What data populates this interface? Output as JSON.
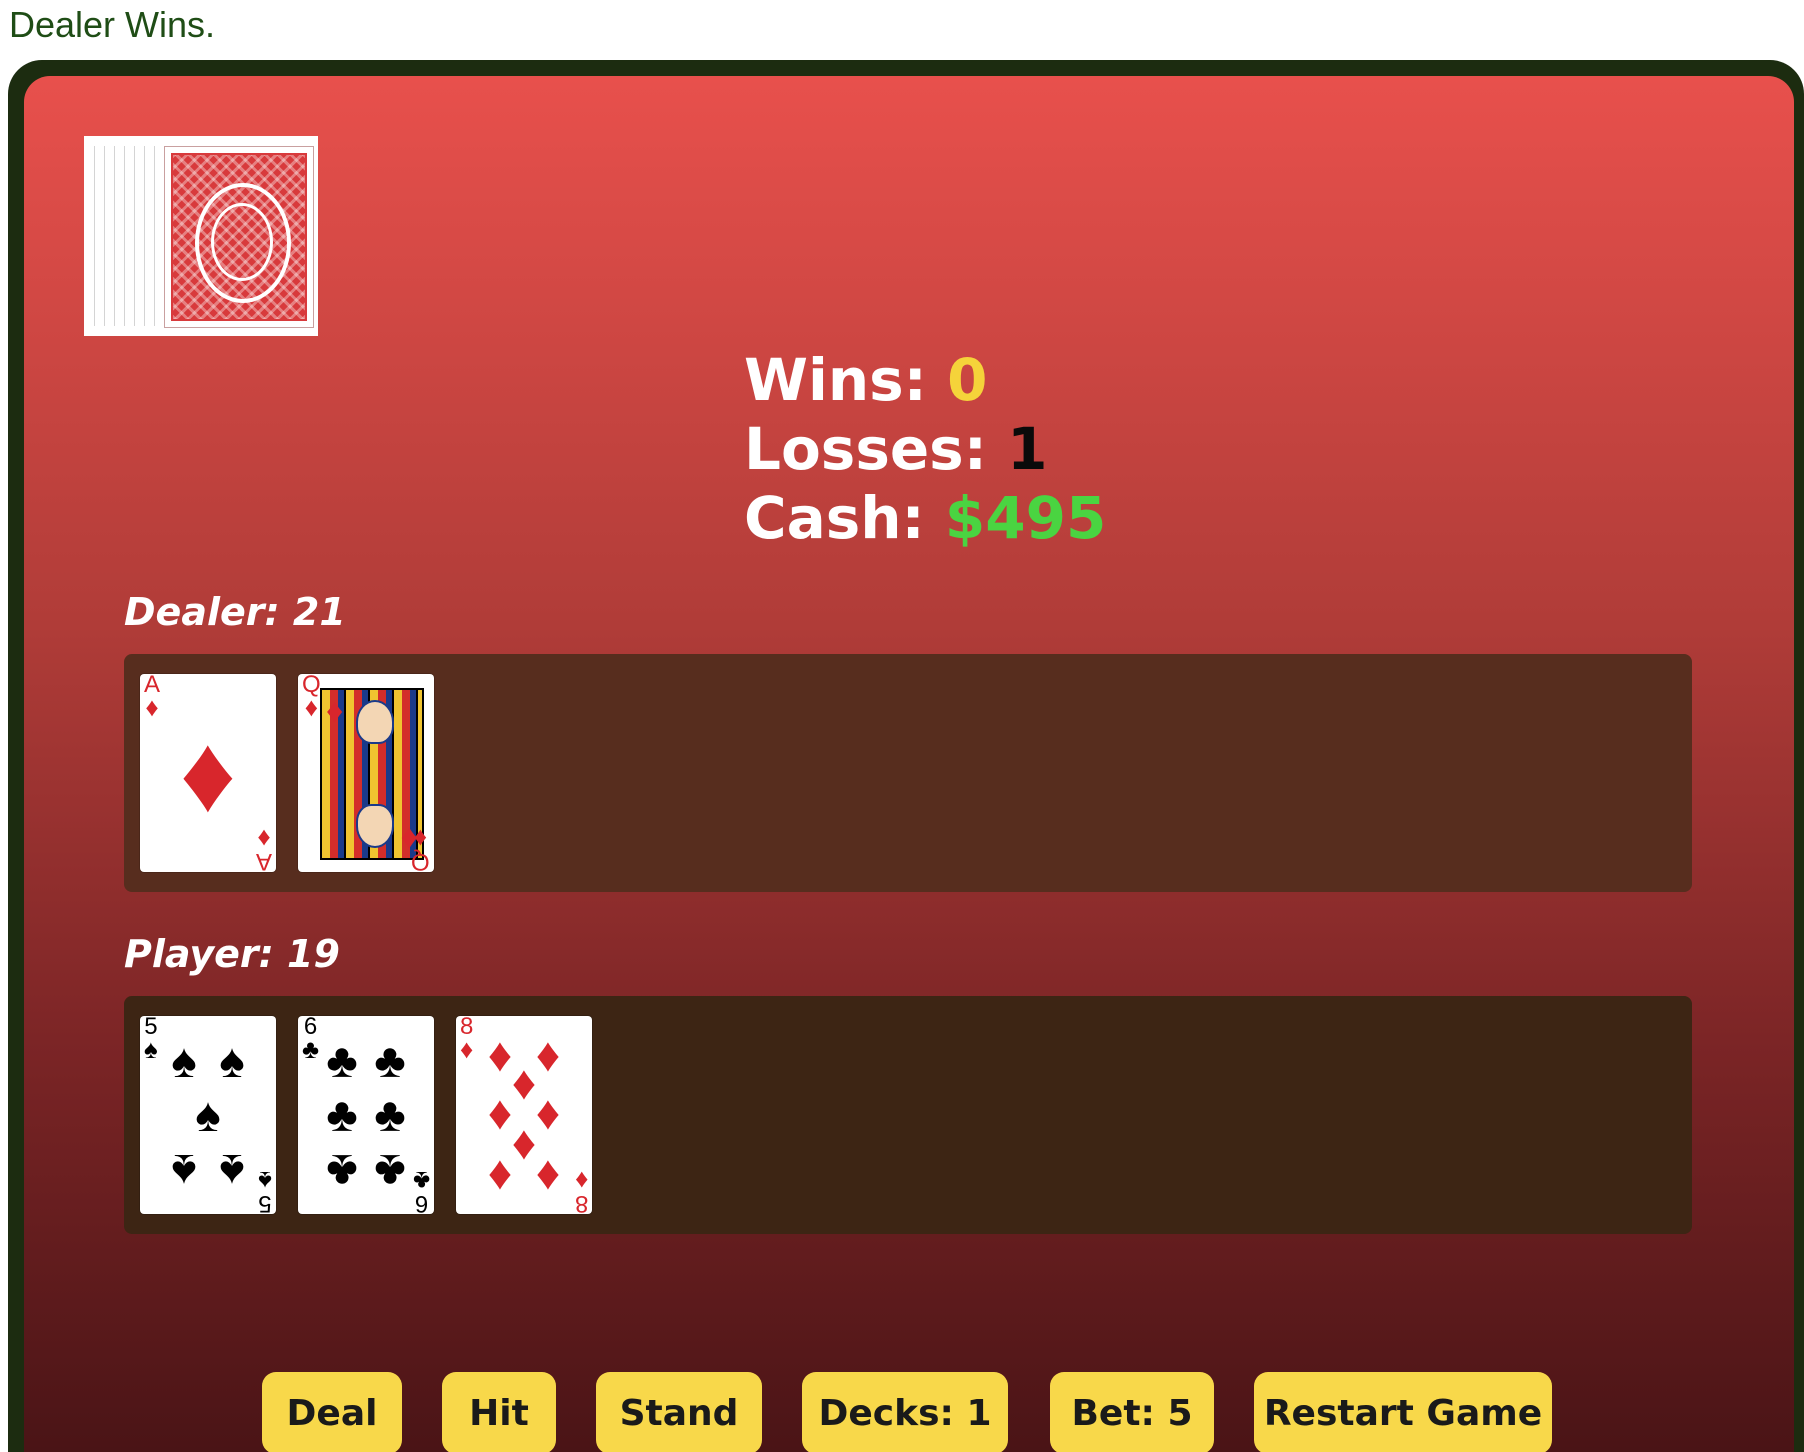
{
  "status_message": "Dealer Wins.",
  "colors": {
    "table_top": "#e8504c",
    "table_bottom": "#4a1416",
    "button": "#f8d84a",
    "wins_value": "#f5d33a",
    "cash_value": "#4ad441"
  },
  "deck": {
    "icon": "card-back-icon"
  },
  "stats": {
    "wins_label": "Wins: ",
    "wins_value": "0",
    "losses_label": "Losses: ",
    "losses_value": "1",
    "cash_label": "Cash: ",
    "cash_value": "$495"
  },
  "dealer": {
    "label": "Dealer: 21",
    "cards": [
      {
        "rank": "A",
        "suit": "♦",
        "color": "red",
        "name": "ace-of-diamonds"
      },
      {
        "rank": "Q",
        "suit": "♦",
        "color": "red",
        "name": "queen-of-diamonds"
      }
    ]
  },
  "player": {
    "label": "Player: 19",
    "cards": [
      {
        "rank": "5",
        "suit": "♠",
        "color": "black",
        "name": "five-of-spades"
      },
      {
        "rank": "6",
        "suit": "♣",
        "color": "black",
        "name": "six-of-clubs"
      },
      {
        "rank": "8",
        "suit": "♦",
        "color": "red",
        "name": "eight-of-diamonds"
      }
    ]
  },
  "controls": {
    "deal": "Deal",
    "hit": "Hit",
    "stand": "Stand",
    "decks": "Decks: 1",
    "bet": "Bet: 5",
    "restart": "Restart Game"
  }
}
